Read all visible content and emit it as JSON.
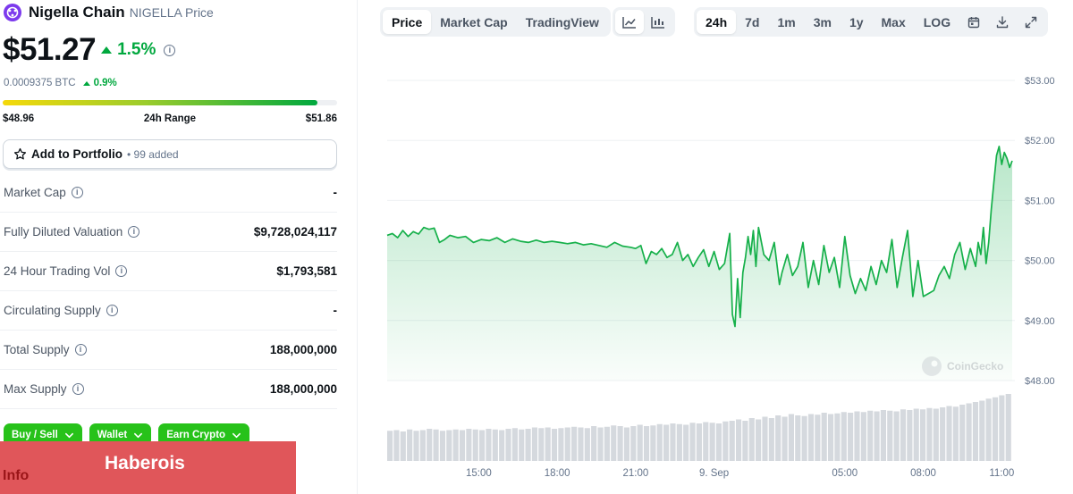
{
  "coin": {
    "name": "Nigella Chain",
    "subtitle": "NIGELLA Price",
    "price": "$51.27",
    "change_24h": "1.5%",
    "btc_price": "0.0009375 BTC",
    "btc_change": "0.9%"
  },
  "range": {
    "low": "$48.96",
    "label": "24h Range",
    "high": "$51.86",
    "fill_fraction": 0.94
  },
  "portfolio": {
    "label": "Add to Portfolio",
    "added": "• 99 added"
  },
  "stats": [
    {
      "label": "Market Cap",
      "value": "-"
    },
    {
      "label": "Fully Diluted Valuation",
      "value": "$9,728,024,117"
    },
    {
      "label": "24 Hour Trading Vol",
      "value": "$1,793,581"
    },
    {
      "label": "Circulating Supply",
      "value": "-"
    },
    {
      "label": "Total Supply",
      "value": "188,000,000"
    },
    {
      "label": "Max Supply",
      "value": "188,000,000"
    }
  ],
  "actions": [
    {
      "label": "Buy / Sell"
    },
    {
      "label": "Wallet"
    },
    {
      "label": "Earn Crypto"
    }
  ],
  "info_label": "Info",
  "banner": "Haberois",
  "toolbar": {
    "chart_tabs": [
      "Price",
      "Market Cap",
      "TradingView"
    ],
    "active_chart_tab": "Price",
    "ranges": [
      "24h",
      "7d",
      "1m",
      "3m",
      "1y",
      "Max",
      "LOG"
    ],
    "active_range": "24h"
  },
  "watermark": "CoinGecko",
  "colors": {
    "accent_green": "#00a83e",
    "button_green": "#27c21a",
    "overlay_red": "#e0565a"
  },
  "chart_data": {
    "type": "line",
    "y_ticks": [
      "$53.00",
      "$52.00",
      "$51.00",
      "$50.00",
      "$49.00",
      "$48.00"
    ],
    "ylim": [
      48,
      53
    ],
    "x_ticks": [
      "15:00",
      "18:00",
      "21:00",
      "9. Sep",
      "05:00",
      "08:00",
      "11:00"
    ],
    "x_tick_hours": [
      15,
      18,
      21,
      24,
      29,
      32,
      35
    ],
    "xlim": [
      11.5,
      35.4
    ],
    "series": [
      {
        "x": [
          11.5,
          11.7,
          11.9,
          12.1,
          12.3,
          12.5,
          12.7,
          12.9,
          13.1,
          13.3,
          13.5,
          13.7,
          13.9,
          14.2,
          14.5,
          14.8,
          15.1,
          15.4,
          15.7,
          16,
          16.3,
          16.6,
          16.9,
          17.2,
          17.5,
          17.8,
          18.1,
          18.4,
          18.7,
          19,
          19.3,
          19.6,
          19.9,
          20.2,
          20.5,
          20.8,
          21,
          21.2,
          21.4,
          21.6,
          21.8,
          22,
          22.2,
          22.4,
          22.6,
          22.8,
          23,
          23.2,
          23.4,
          23.6,
          23.8,
          24,
          24.2,
          24.4,
          24.6,
          24.7,
          24.8,
          24.9,
          25,
          25.1,
          25.2,
          25.3,
          25.4,
          25.5,
          25.6,
          25.7,
          25.9,
          26.1,
          26.3,
          26.5,
          26.6,
          26.8,
          27,
          27.2,
          27.4,
          27.6,
          27.8,
          28,
          28.2,
          28.4,
          28.6,
          28.8,
          29,
          29.2,
          29.4,
          29.6,
          29.8,
          30,
          30.2,
          30.4,
          30.6,
          30.8,
          31,
          31.2,
          31.4,
          31.6,
          31.8,
          32,
          32.2,
          32.4,
          32.6,
          32.8,
          33,
          33.2,
          33.4,
          33.6,
          33.8,
          34,
          34.1,
          34.2,
          34.3,
          34.4,
          34.5,
          34.6,
          34.7,
          34.8,
          34.9,
          35,
          35.1,
          35.2,
          35.3,
          35.4
        ],
        "y": [
          50.42,
          50.45,
          50.38,
          50.5,
          50.4,
          50.48,
          50.44,
          50.55,
          50.52,
          50.54,
          50.3,
          50.35,
          50.42,
          50.38,
          50.4,
          50.3,
          50.35,
          50.33,
          50.38,
          50.3,
          50.36,
          50.32,
          50.3,
          50.34,
          50.3,
          50.32,
          50.3,
          50.28,
          50.3,
          50.26,
          50.28,
          50.25,
          50.22,
          50.3,
          50.24,
          50.22,
          50.2,
          50.25,
          49.95,
          50.15,
          50.1,
          50.2,
          50.05,
          50.1,
          50.3,
          50.0,
          50.1,
          49.9,
          50.05,
          50.18,
          49.9,
          50.15,
          49.85,
          49.95,
          50.45,
          49.1,
          48.9,
          49.7,
          49.05,
          49.8,
          50.05,
          50.4,
          50.1,
          50.5,
          49.9,
          50.55,
          50.1,
          50.0,
          50.3,
          49.6,
          49.8,
          50.1,
          49.75,
          49.9,
          50.3,
          49.55,
          50.0,
          49.6,
          50.25,
          49.8,
          50.05,
          49.55,
          50.4,
          49.75,
          49.45,
          49.7,
          49.5,
          49.9,
          49.6,
          50.0,
          49.8,
          50.35,
          49.55,
          50.05,
          50.5,
          49.4,
          50.0,
          49.4,
          49.45,
          49.5,
          49.75,
          49.9,
          49.7,
          50.1,
          50.3,
          49.85,
          50.2,
          49.9,
          50.3,
          50.1,
          50.55,
          49.95,
          50.3,
          50.85,
          51.3,
          51.75,
          51.9,
          51.6,
          51.8,
          51.7,
          51.55,
          51.66
        ]
      }
    ],
    "volume": {
      "x_start": 11.5,
      "x_end": 35.4,
      "values": [
        0.45,
        0.46,
        0.44,
        0.47,
        0.45,
        0.46,
        0.48,
        0.47,
        0.45,
        0.46,
        0.47,
        0.46,
        0.48,
        0.47,
        0.46,
        0.48,
        0.47,
        0.46,
        0.48,
        0.49,
        0.47,
        0.48,
        0.5,
        0.49,
        0.5,
        0.48,
        0.49,
        0.5,
        0.51,
        0.5,
        0.49,
        0.52,
        0.5,
        0.51,
        0.53,
        0.52,
        0.5,
        0.52,
        0.54,
        0.52,
        0.53,
        0.55,
        0.54,
        0.56,
        0.55,
        0.54,
        0.57,
        0.56,
        0.58,
        0.57,
        0.56,
        0.59,
        0.6,
        0.62,
        0.6,
        0.64,
        0.62,
        0.66,
        0.64,
        0.68,
        0.66,
        0.7,
        0.68,
        0.67,
        0.7,
        0.69,
        0.72,
        0.7,
        0.71,
        0.73,
        0.72,
        0.74,
        0.73,
        0.75,
        0.74,
        0.76,
        0.75,
        0.74,
        0.77,
        0.76,
        0.78,
        0.77,
        0.79,
        0.78,
        0.8,
        0.82,
        0.81,
        0.84,
        0.86,
        0.88,
        0.9,
        0.93,
        0.95,
        0.98,
        1.0
      ]
    },
    "grid": true,
    "legend": "none"
  }
}
